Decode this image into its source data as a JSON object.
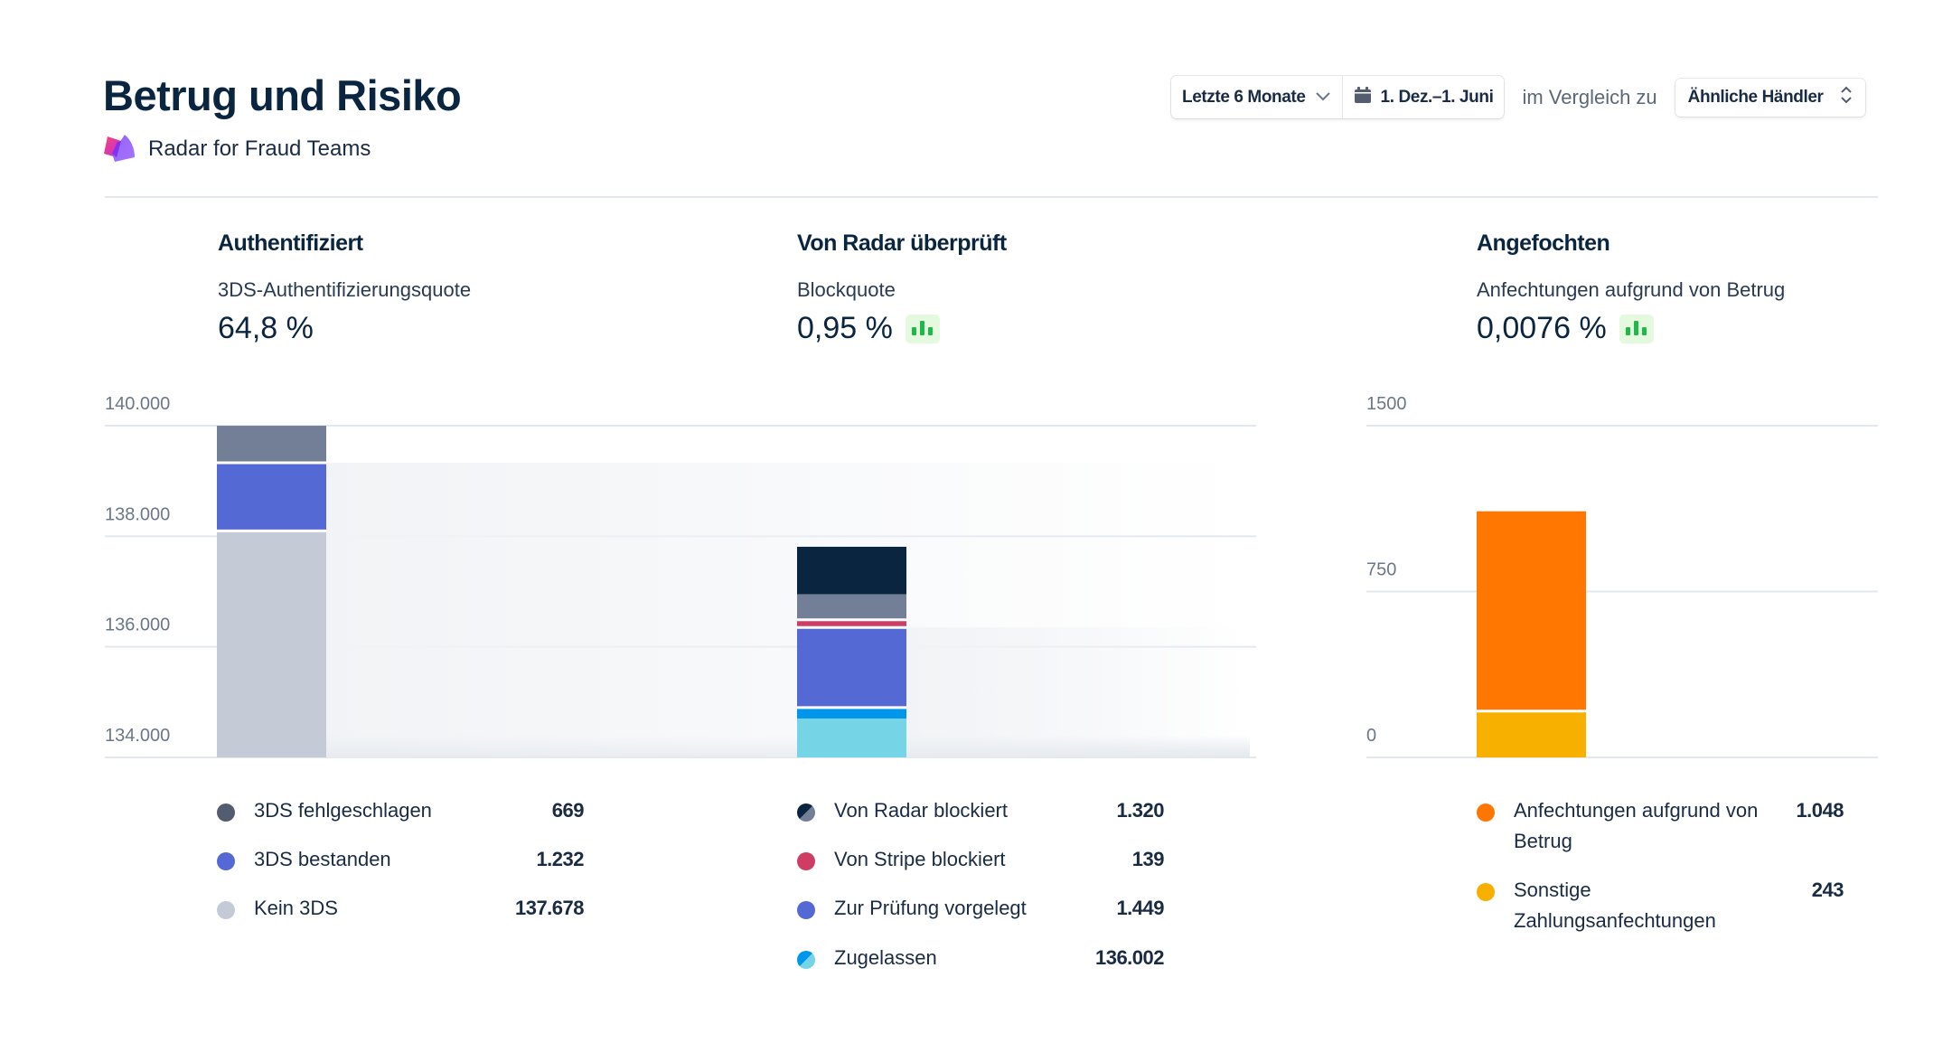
{
  "header": {
    "title": "Betrug und Risiko",
    "product_name": "Radar for Fraud Teams",
    "logo_icon": "radar-logo-icon"
  },
  "controls": {
    "period_label": "Letzte 6 Monate",
    "period_icon": "chevron-down-icon",
    "date_range_icon": "calendar-icon",
    "date_range_label": "1. Dez.–1. Juni",
    "compare_label": "im Vergleich zu",
    "compare_select_label": "Ähnliche Händler",
    "compare_select_icon": "chevron-up-down-icon"
  },
  "metrics": [
    {
      "title": "Authentifiziert",
      "subtitle": "3DS-Authentifizierungsquote",
      "value": "64,8 %",
      "badge": false
    },
    {
      "title": "Von Radar überprüft",
      "subtitle": "Blockquote",
      "value": "0,95 %",
      "badge": true,
      "badge_icon": "bar-chart-icon"
    },
    {
      "title": "Angefochten",
      "subtitle": "Anfechtungen aufgrund von Betrug",
      "value": "0,0076 %",
      "badge": true,
      "badge_icon": "bar-chart-icon"
    }
  ],
  "colors": {
    "grid": "#e3e8ee",
    "band": "#f1f3f6",
    "trend_badge_bg": "#e4f9dd",
    "trend_badge_fg": "#1fb94a"
  },
  "chart_data": [
    {
      "type": "bar",
      "stacked": true,
      "title": "Authentifiziert",
      "yticks": [
        "140.000",
        "138.000",
        "136.000",
        "134.000"
      ],
      "ylim": [
        134000,
        140000
      ],
      "grid": true,
      "series": [
        {
          "name": "Kein 3DS",
          "value": 137678,
          "display": "137.678",
          "color": "#c4cbd6"
        },
        {
          "name": "3DS bestanden",
          "value": 1232,
          "display": "1.232",
          "color": "#5469d4"
        },
        {
          "name": "3DS fehlgeschlagen",
          "value": 669,
          "display": "669",
          "color": "#727f96"
        }
      ],
      "legend": [
        {
          "label": "3DS fehlgeschlagen",
          "value": "669",
          "color": "#545c6f"
        },
        {
          "label": "3DS bestanden",
          "value": "1.232",
          "color": "#5469d4"
        },
        {
          "label": "Kein 3DS",
          "value": "137.678",
          "color": "#c4cbd6"
        }
      ]
    },
    {
      "type": "bar",
      "stacked": true,
      "title": "Von Radar überprüft",
      "yticks": [
        "140.000",
        "138.000",
        "136.000",
        "134.000"
      ],
      "ylim": [
        134000,
        140000
      ],
      "grid": true,
      "series": [
        {
          "name": "Zugelassen",
          "value": 136002,
          "display": "136.002",
          "colors": [
            "#76d4e7",
            "#0096eb"
          ]
        },
        {
          "name": "Zur Prüfung vorgelegt",
          "value": 1449,
          "display": "1.449",
          "color": "#5469d4"
        },
        {
          "name": "Von Stripe blockiert",
          "value": 139,
          "display": "139",
          "color": "#cd3d64"
        },
        {
          "name": "Von Radar blockiert",
          "value": 1320,
          "display": "1.320",
          "colors": [
            "#727f96",
            "#0a2540"
          ]
        }
      ],
      "legend": [
        {
          "label": "Von Radar blockiert",
          "value": "1.320",
          "colors": [
            "#0a2540",
            "#727f96"
          ]
        },
        {
          "label": "Von Stripe blockiert",
          "value": "139",
          "color": "#cd3d64"
        },
        {
          "label": "Zur Prüfung vorgelegt",
          "value": "1.449",
          "color": "#5469d4"
        },
        {
          "label": "Zugelassen",
          "value": "136.002",
          "colors": [
            "#0096eb",
            "#76d4e7"
          ]
        }
      ]
    },
    {
      "type": "bar",
      "stacked": true,
      "title": "Angefochten",
      "yticks": [
        "1500",
        "750",
        "0"
      ],
      "ylim": [
        0,
        1500
      ],
      "grid": true,
      "series": [
        {
          "name": "Sonstige Zahlungsanfechtungen",
          "value": 243,
          "display": "243",
          "color": "#f8b000"
        },
        {
          "name": "Anfechtungen aufgrund von Betrug",
          "value": 1048,
          "display": "1.048",
          "color": "#ff7600"
        }
      ],
      "legend": [
        {
          "label": "Anfechtungen aufgrund von Betrug",
          "value": "1.048",
          "color": "#ff7600"
        },
        {
          "label": "Sonstige Zahlungsanfechtungen",
          "value": "243",
          "color": "#f8b000"
        }
      ]
    }
  ]
}
